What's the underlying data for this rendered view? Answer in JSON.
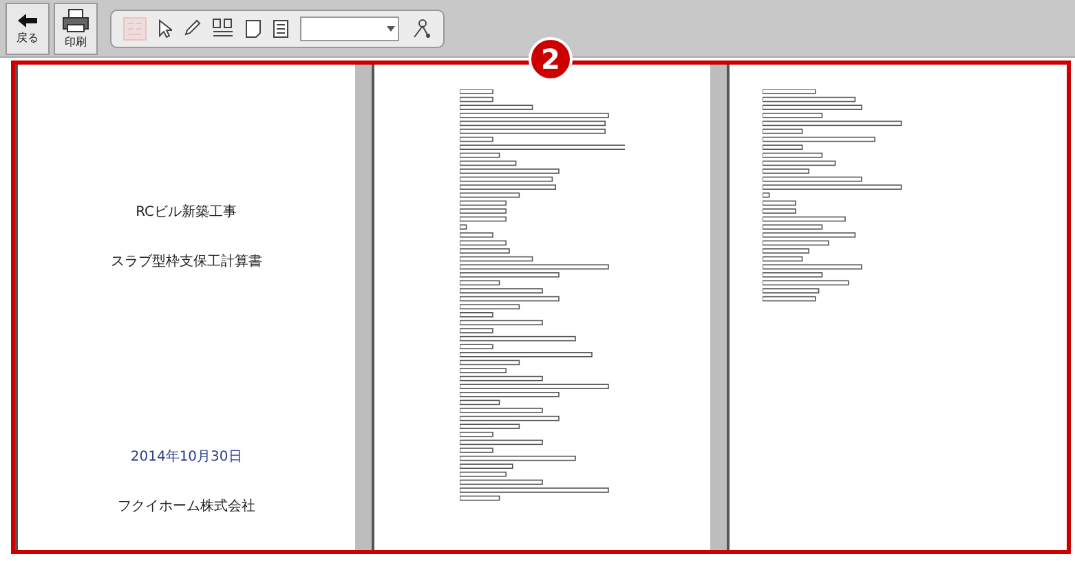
{
  "toolbar": {
    "buttons": [
      {
        "kind": "back",
        "label": "戻る"
      },
      {
        "kind": "print",
        "label": "印刷"
      }
    ],
    "tools": [
      {
        "kind": "pack",
        "disabled": true
      },
      {
        "kind": "pointer",
        "disabled": false
      },
      {
        "kind": "pencil",
        "disabled": false
      },
      {
        "kind": "edit",
        "disabled": false
      },
      {
        "kind": "page",
        "disabled": false
      },
      {
        "kind": "list",
        "disabled": false
      },
      {
        "kind": "select",
        "disabled": false
      },
      {
        "kind": "tool",
        "disabled": false
      }
    ]
  },
  "badge": "2",
  "pages": [
    {
      "kind": "cover",
      "lines": [
        {
          "text": "RCビル新築工事",
          "kind": "title"
        },
        {
          "text": "スラブ型枠支保工計算書",
          "kind": "title"
        },
        {
          "text": "2014年10月30日",
          "kind": "date"
        },
        {
          "text": "フクイホーム株式会社",
          "kind": "company"
        }
      ]
    },
    {
      "kind": "garbled"
    },
    {
      "kind": "garbled"
    }
  ]
}
